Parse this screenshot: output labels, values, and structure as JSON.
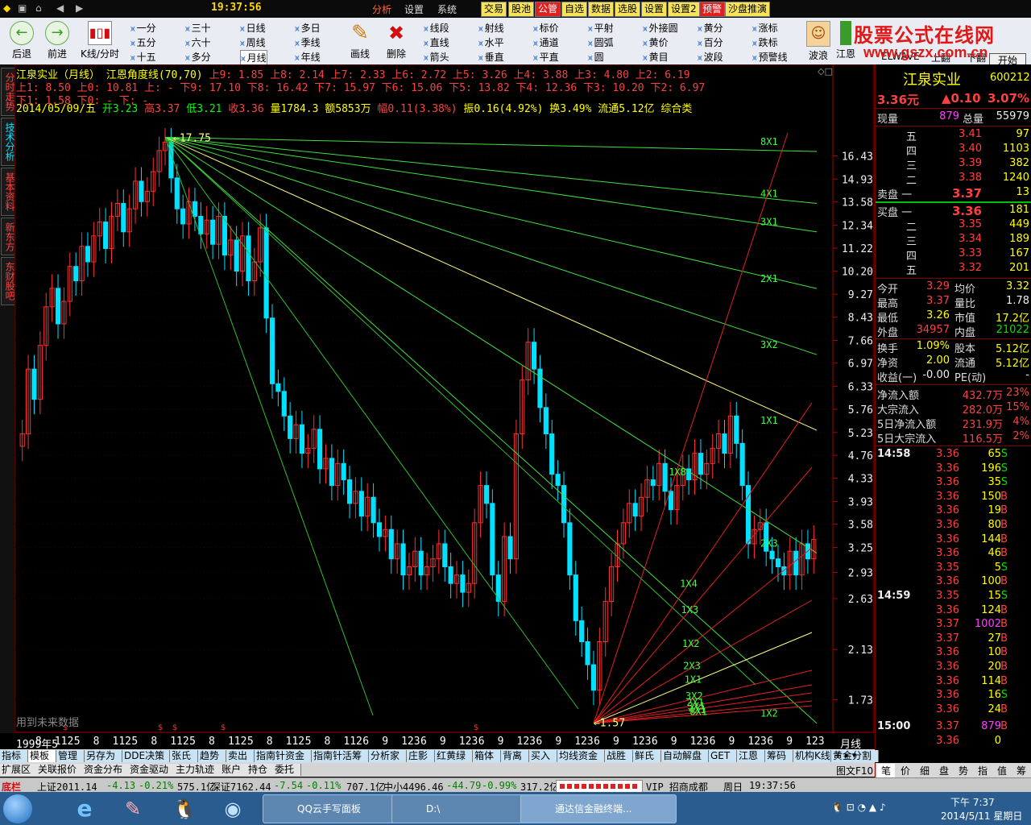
{
  "menubar": {
    "clock": "19:37:56",
    "items": [
      "分析",
      "设置",
      "系统"
    ],
    "buttons": [
      "交易",
      "股池",
      "公管",
      "自选",
      "数据",
      "选股",
      "设置",
      "设置2",
      "预警",
      "沙盘推演"
    ]
  },
  "toolbar": {
    "back": "后退",
    "forward": "前进",
    "kline_toggle": "K线/分时",
    "periods": [
      [
        "一分",
        "三十",
        "日线",
        "多日"
      ],
      [
        "五分",
        "六十",
        "周线",
        "季线"
      ],
      [
        "十五",
        "多分",
        "月线",
        "年线"
      ]
    ],
    "draw_tool": "画线",
    "delete_tool": "删除",
    "line_tools": [
      [
        "线段",
        "射线",
        "标价",
        "平射",
        "外接圆",
        "黄分",
        "涨标"
      ],
      [
        "直线",
        "水平",
        "通道",
        "圆弧",
        "黄价",
        "百分",
        "跌标"
      ],
      [
        "箭头",
        "垂直",
        "平直",
        "圆",
        "黄目",
        "波段",
        "预警线"
      ]
    ],
    "right_tools": [
      "波浪",
      "江恩",
      "ELWAVE",
      "上翻",
      "下翻"
    ],
    "open_btn": "开始",
    "logo_text": "股票公式在线网",
    "logo_url": "www.gszx.com.cn"
  },
  "vtabs": [
    "分时走势",
    "技术分析",
    "基本资料",
    "新东方",
    "东财股吧"
  ],
  "header": {
    "line1_title": "江泉实业（月线） 江恩角度线(70,70)",
    "line1_values": "上9: 1.85 上8: 2.14 上7: 2.33 上6: 2.72 上5: 3.26 上4: 3.88 上3: 4.80 上2: 6.19",
    "line2": "上1: 8.50 上0: 10.81 上: - 下9: 17.10 下8: 16.42 下7: 15.97 下6: 15.06 下5: 13.82 下4: 12.36 下3: 10.20 下2: 6.97",
    "line3": "下1: 1.58 下0: - 下: -",
    "date": "2014/05/09/五",
    "open": "开3.23",
    "high": "高3.37",
    "low": "低3.21",
    "close": "收3.36",
    "volume": "量1784.3",
    "amount": "额5853万",
    "range": "幅0.11(3.38%)",
    "amplitude": "振0.16(4.92%)",
    "turnover": "换3.49%",
    "float": "流通5.12亿",
    "category": "综合类"
  },
  "chart_data": {
    "type": "candlestick",
    "title": "江泉实业（月线）",
    "indicator": "江恩角度线(70,70)",
    "y_ticks": [
      16.43,
      14.93,
      13.58,
      12.34,
      11.22,
      10.2,
      9.27,
      8.43,
      7.66,
      6.97,
      6.33,
      5.76,
      5.23,
      4.76,
      4.33,
      3.93,
      3.58,
      3.25,
      2.93,
      2.63,
      2.13,
      1.73
    ],
    "ylim": [
      1.6,
      19.0
    ],
    "high_mark": "17.75",
    "low_mark": "1.57",
    "watermark": "用到未来数据",
    "x_labels": [
      "1999年5",
      "8",
      "112",
      "5",
      "8",
      "112",
      "5",
      "8",
      "112",
      "5",
      "8",
      "112",
      "5",
      "8",
      "112",
      "5",
      "8",
      "112",
      "6",
      "9",
      "123",
      "6",
      "9",
      "123",
      "6",
      "9",
      "123",
      "6",
      "9",
      "123",
      "6",
      "9",
      "123",
      "6",
      "9",
      "123",
      "6",
      "9",
      "123",
      "6",
      "9",
      "123"
    ],
    "period_label": "月线",
    "fan_top_labels": [
      "8X1",
      "4X1",
      "3X1",
      "2X1",
      "3X2",
      "1X1",
      "2X3",
      "1X2"
    ],
    "fan_bottom_labels": [
      "1X8",
      "1X4",
      "1X3",
      "1X2",
      "2X3",
      "1X1",
      "3X2",
      "2X1",
      "3X1",
      "4X1",
      "8X1"
    ],
    "close_series": [
      5.2,
      6.8,
      6.0,
      7.5,
      8.8,
      9.5,
      8.2,
      9.0,
      10.4,
      9.8,
      11.3,
      10.6,
      11.8,
      12.5,
      11.2,
      12.8,
      13.5,
      12.0,
      13.2,
      14.8,
      13.6,
      14.2,
      15.4,
      16.8,
      17.4,
      15.0,
      13.2,
      12.4,
      13.6,
      12.8,
      11.9,
      12.6,
      11.4,
      12.8,
      10.9,
      11.6,
      10.2,
      11.8,
      9.8,
      10.6,
      12.2,
      8.4,
      6.4,
      6.2,
      5.6,
      5.1,
      5.4,
      4.8,
      4.9,
      5.3,
      4.5,
      4.7,
      4.2,
      4.6,
      4.3,
      3.9,
      4.1,
      3.7,
      4.0,
      3.6,
      3.4,
      3.5,
      3.1,
      3.3,
      2.9,
      3.0,
      3.2,
      2.9,
      3.0,
      3.1,
      3.3,
      3.0,
      2.8,
      2.9,
      2.7,
      2.8,
      3.6,
      4.2,
      3.9,
      2.9,
      2.6,
      3.4,
      3.1,
      5.2,
      6.5,
      7.6,
      6.8,
      5.8,
      5.2,
      4.4,
      4.2,
      3.6,
      2.9,
      2.4,
      2.2,
      2.0,
      1.8,
      2.2,
      2.6,
      3.0,
      3.3,
      3.6,
      3.9,
      3.7,
      4.0,
      4.3,
      4.2,
      4.6,
      4.1,
      3.8,
      4.2,
      4.5,
      4.3,
      4.8,
      4.4,
      4.6,
      4.9,
      5.2,
      4.8,
      5.6,
      5.0,
      4.2,
      3.3,
      3.5,
      3.6,
      3.2,
      3.1,
      3.0,
      2.9,
      3.2,
      2.9,
      3.3,
      3.1,
      3.36
    ]
  },
  "quote": {
    "name": "江泉实业",
    "code": "600212",
    "price": "3.36元",
    "change": "▲0.10",
    "change_pct": "3.07%",
    "now_hand_label": "现量",
    "now_hand": "879",
    "total_label": "总量",
    "total": "55979",
    "sell": [
      [
        "五",
        "3.41",
        "97"
      ],
      [
        "四",
        "3.40",
        "1103"
      ],
      [
        "三",
        "3.39",
        "382"
      ],
      [
        "二",
        "3.38",
        "1240"
      ],
      [
        "卖盘 一",
        "3.37",
        "13"
      ]
    ],
    "buy": [
      [
        "买盘 一",
        "3.36",
        "181"
      ],
      [
        "二",
        "3.35",
        "449"
      ],
      [
        "三",
        "3.34",
        "189"
      ],
      [
        "四",
        "3.33",
        "167"
      ],
      [
        "五",
        "3.32",
        "201"
      ]
    ],
    "stats": [
      [
        "今开",
        "3.29",
        "均价",
        "3.32"
      ],
      [
        "最高",
        "3.37",
        "量比",
        "1.78"
      ],
      [
        "最低",
        "3.26",
        "市值",
        "17.2亿"
      ],
      [
        "外盘",
        "34957",
        "内盘",
        "21022"
      ],
      [
        "换手",
        "1.09%",
        "股本",
        "5.12亿"
      ],
      [
        "净资",
        "2.00",
        "流通",
        "5.12亿"
      ],
      [
        "收益(一)",
        "-0.00",
        "PE(动)",
        "-"
      ]
    ],
    "flows": [
      [
        "净流入额",
        "432.7万",
        "23%"
      ],
      [
        "大宗流入",
        "282.0万",
        "15%"
      ],
      [
        "5日净流入额",
        "231.9万",
        "4%"
      ],
      [
        "5日大宗流入",
        "116.5万",
        "2%"
      ]
    ],
    "ticks": [
      [
        "14:58",
        "3.36",
        "65",
        "S"
      ],
      [
        "",
        "3.36",
        "196",
        "S"
      ],
      [
        "",
        "3.36",
        "35",
        "S"
      ],
      [
        "",
        "3.36",
        "150",
        "B"
      ],
      [
        "",
        "3.36",
        "19",
        "B"
      ],
      [
        "",
        "3.36",
        "80",
        "B"
      ],
      [
        "",
        "3.36",
        "144",
        "B"
      ],
      [
        "",
        "3.36",
        "46",
        "B"
      ],
      [
        "",
        "3.35",
        "5",
        "S"
      ],
      [
        "",
        "3.36",
        "100",
        "B"
      ],
      [
        "14:59",
        "3.35",
        "15",
        "S"
      ],
      [
        "",
        "3.36",
        "124",
        "B"
      ],
      [
        "",
        "3.37",
        "1002",
        "B"
      ],
      [
        "",
        "3.37",
        "27",
        "B"
      ],
      [
        "",
        "3.36",
        "10",
        "B"
      ],
      [
        "",
        "3.36",
        "20",
        "B"
      ],
      [
        "",
        "3.36",
        "114",
        "B"
      ],
      [
        "",
        "3.36",
        "16",
        "S"
      ],
      [
        "",
        "3.36",
        "24",
        "B"
      ],
      [
        "15:00",
        "3.37",
        "879",
        "B"
      ],
      [
        "",
        "3.36",
        "0",
        ""
      ]
    ],
    "bottom_tabs": [
      "笔",
      "价",
      "细",
      "盘",
      "势",
      "指",
      "值",
      "筹"
    ]
  },
  "bottom_tabs": [
    "指标",
    "模板",
    "管理",
    "另存为",
    "DDE决策",
    "张氏",
    "趋势",
    "卖出",
    "指南针资金",
    "指南针活筹",
    "分析家",
    "庄影",
    "红黄绿",
    "箱体",
    "背离",
    "买入",
    "均线资金",
    "战胜",
    "鲜氏",
    "自动解盘",
    "GET",
    "江恩",
    "筹码",
    "机构K线",
    "黄金分割"
  ],
  "ext_tabs": [
    "扩展区",
    "关联报价",
    "资金分布",
    "资金驱动",
    "主力轨迹",
    "账户",
    "持仓",
    "委托"
  ],
  "ext_right": "图文F10",
  "status": {
    "label": "底栏",
    "sh": "上证2011.14",
    "sh_chg": "-4.13",
    "sh_pct": "-0.21%",
    "sh_amt": "575.1亿",
    "sz": "深证7162.44",
    "sz_chg": "-7.54",
    "sz_pct": "-0.11%",
    "sz_amt": "707.1亿",
    "zx": "中小4496.46",
    "zx_chg": "-44.79",
    "zx_pct": "-0.99%",
    "zx_amt": "317.2亿",
    "vip": "VIP_招商成都",
    "day": "周日",
    "time": "19:37:56"
  },
  "taskbar": {
    "tasks": [
      "QQ云手写面板",
      "D:\\",
      "通达信金融终端..."
    ],
    "clock_time": "下午 7:37",
    "clock_date": "2014/5/11 星期日"
  }
}
